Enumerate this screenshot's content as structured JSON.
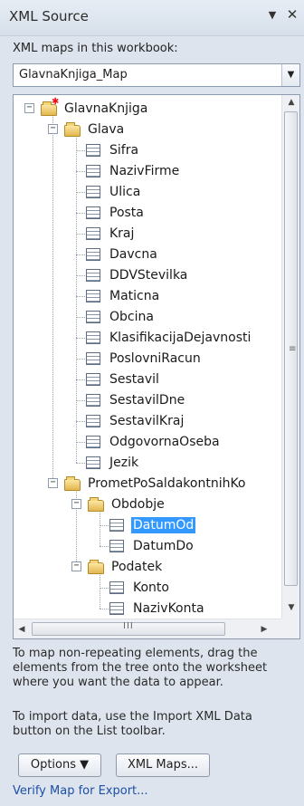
{
  "pane": {
    "title": "XML Source",
    "dropdown_icon": "▼",
    "close_icon": "✕"
  },
  "maps_label": "XML maps in this workbook:",
  "map_select": {
    "value": "GlavnaKnjiga_Map"
  },
  "tree": {
    "root": "GlavnaKnjiga",
    "glava": {
      "label": "Glava",
      "children": [
        "Sifra",
        "NazivFirme",
        "Ulica",
        "Posta",
        "Kraj",
        "Davcna",
        "DDVStevilka",
        "Maticna",
        "Obcina",
        "KlasifikacijaDejavnosti",
        "PoslovniRacun",
        "Sestavil",
        "SestavilDne",
        "SestavilKraj",
        "OdgovornaOseba",
        "Jezik"
      ]
    },
    "promet": {
      "label": "PrometPoSaldakontnihKo",
      "obdobje": {
        "label": "Obdobje",
        "children": [
          "DatumOd",
          "DatumDo"
        ],
        "selected": "DatumOd"
      },
      "podatek": {
        "label": "Podatek",
        "children": [
          "Konto",
          "NazivKonta"
        ]
      }
    },
    "hscroll_grip": "III"
  },
  "help": {
    "mapping": [
      "To map non-repeating elements, drag the",
      "elements from the tree onto the worksheet",
      "where you want the data to appear."
    ],
    "import": [
      "To import data, use the Import XML Data",
      "button on the List toolbar."
    ]
  },
  "buttons": {
    "options": "Options ▼",
    "xml_maps": "XML Maps..."
  },
  "verify_link": "Verify Map for Export..."
}
